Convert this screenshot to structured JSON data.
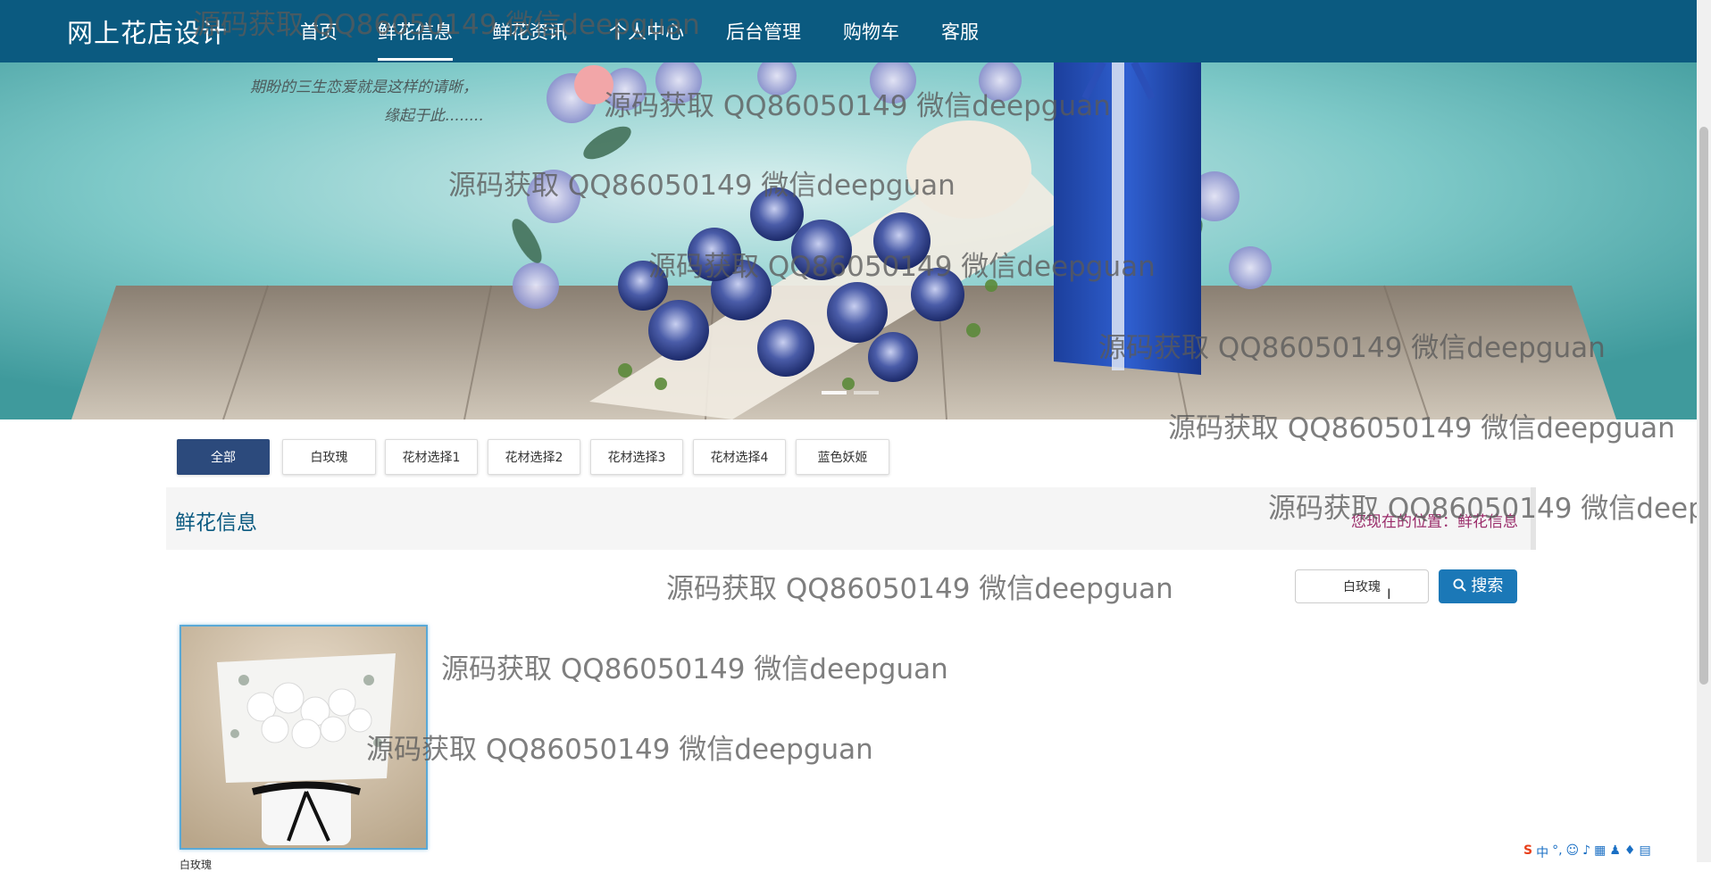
{
  "app": {
    "brand": "网上花店设计",
    "nav": [
      {
        "label": "首页",
        "active": false
      },
      {
        "label": "鲜花信息",
        "active": true
      },
      {
        "label": "鲜花资讯",
        "active": false
      },
      {
        "label": "个人中心",
        "active": false
      },
      {
        "label": "后台管理",
        "active": false
      },
      {
        "label": "购物车",
        "active": false
      },
      {
        "label": "客服",
        "active": false
      }
    ]
  },
  "banner": {
    "poem_lines": [
      "期盼的三生恋爱就是这样的请晰，",
      "缘起于此........"
    ]
  },
  "filters": [
    {
      "label": "全部",
      "active": true
    },
    {
      "label": "白玫瑰",
      "active": false
    },
    {
      "label": "花材选择1",
      "active": false
    },
    {
      "label": "花材选择2",
      "active": false
    },
    {
      "label": "花材选择3",
      "active": false
    },
    {
      "label": "花材选择4",
      "active": false
    },
    {
      "label": "蓝色妖姬",
      "active": false
    }
  ],
  "section": {
    "title": "鲜花信息",
    "breadcrumb": "您现在的位置：鲜花信息"
  },
  "search": {
    "value": "白玫瑰",
    "button_label": "搜索"
  },
  "products": [
    {
      "name": "白玫瑰"
    }
  ],
  "watermark_text": "源码获取 QQ86050149 微信deepguan",
  "tray": {
    "ime": "S",
    "lang": "中"
  },
  "colors": {
    "nav_bg": "#0b5a80",
    "active_filter": "#2c4a7c",
    "search_button": "#1b78b7",
    "breadcrumb": "#9a2c6a"
  }
}
